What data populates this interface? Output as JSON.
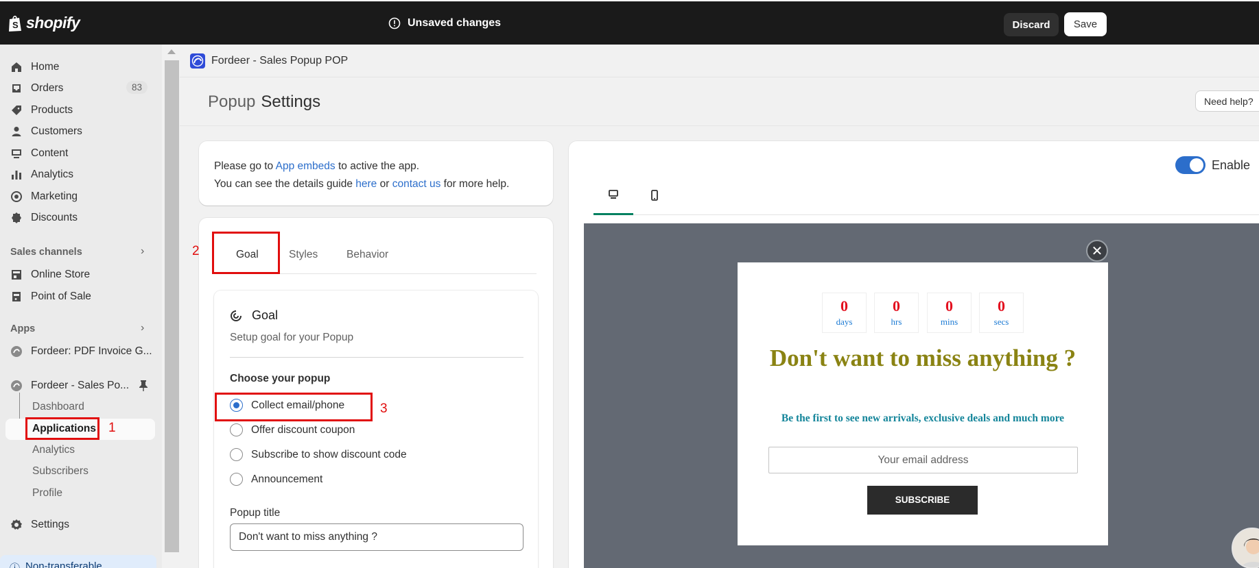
{
  "topbar": {
    "brand": "shopify",
    "unsaved_text": "Unsaved changes",
    "discard_label": "Discard",
    "save_label": "Save"
  },
  "sidebar": {
    "items": [
      {
        "label": "Home",
        "icon": "home-icon"
      },
      {
        "label": "Orders",
        "icon": "orders-icon"
      },
      {
        "label": "Products",
        "icon": "tag-icon"
      },
      {
        "label": "Customers",
        "icon": "person-icon"
      },
      {
        "label": "Content",
        "icon": "content-icon"
      },
      {
        "label": "Analytics",
        "icon": "bar-chart-icon"
      },
      {
        "label": "Marketing",
        "icon": "target-icon"
      },
      {
        "label": "Discounts",
        "icon": "discount-icon"
      }
    ],
    "orders_count": "83",
    "sales_channels_title": "Sales channels",
    "channels": [
      "Online Store",
      "Point of Sale"
    ],
    "apps_title": "Apps",
    "apps": [
      "Fordeer: PDF Invoice G...",
      "Fordeer - Sales Po..."
    ],
    "sub_items": [
      "Dashboard",
      "Applications",
      "Analytics",
      "Subscribers",
      "Profile"
    ],
    "settings_label": "Settings",
    "non_transferable": "Non-transferable"
  },
  "annotations": {
    "one": "1",
    "two": "2",
    "three": "3"
  },
  "app": {
    "title": "Fordeer - Sales Popup POP",
    "breadcrumb_parent": "Popup",
    "page_title": "Settings",
    "help_label": "Need help?"
  },
  "notice": {
    "line1_pre": "Please go to ",
    "line1_link": "App embeds",
    "line1_post": " to active the app.",
    "line2_pre": "You can see the details guide ",
    "line2_link1": "here",
    "line2_mid": " or ",
    "line2_link2": "contact us",
    "line2_post": " for more help."
  },
  "settings": {
    "tabs": [
      "Goal",
      "Styles",
      "Behavior"
    ],
    "goal_title": "Goal",
    "goal_subtitle": "Setup goal for your Popup",
    "choose_label": "Choose your popup",
    "options": [
      "Collect email/phone",
      "Offer discount coupon",
      "Subscribe to show discount code",
      "Announcement"
    ],
    "selected_option": "Collect email/phone",
    "popup_title_label": "Popup title",
    "popup_title_value": "Don't want to miss anything ?"
  },
  "preview": {
    "enable_label": "Enable",
    "enabled": true,
    "countdown": [
      {
        "value": "0",
        "unit": "days"
      },
      {
        "value": "0",
        "unit": "hrs"
      },
      {
        "value": "0",
        "unit": "mins"
      },
      {
        "value": "0",
        "unit": "secs"
      }
    ],
    "title": "Don't want to miss anything ?",
    "subtitle": "Be the first to see new arrivals, exclusive deals and much more",
    "email_placeholder": "Your email address",
    "button_label": "SUBSCRIBE",
    "close_glyph": "✕"
  },
  "colors": {
    "topbar": "#1a1a1a",
    "accent_blue": "#2c6ecb",
    "annotation_red": "#e10d0d",
    "popup_title": "#8a8313",
    "popup_subtitle": "#14859a",
    "countdown_number": "#e3101f",
    "tab_active": "#008060"
  }
}
